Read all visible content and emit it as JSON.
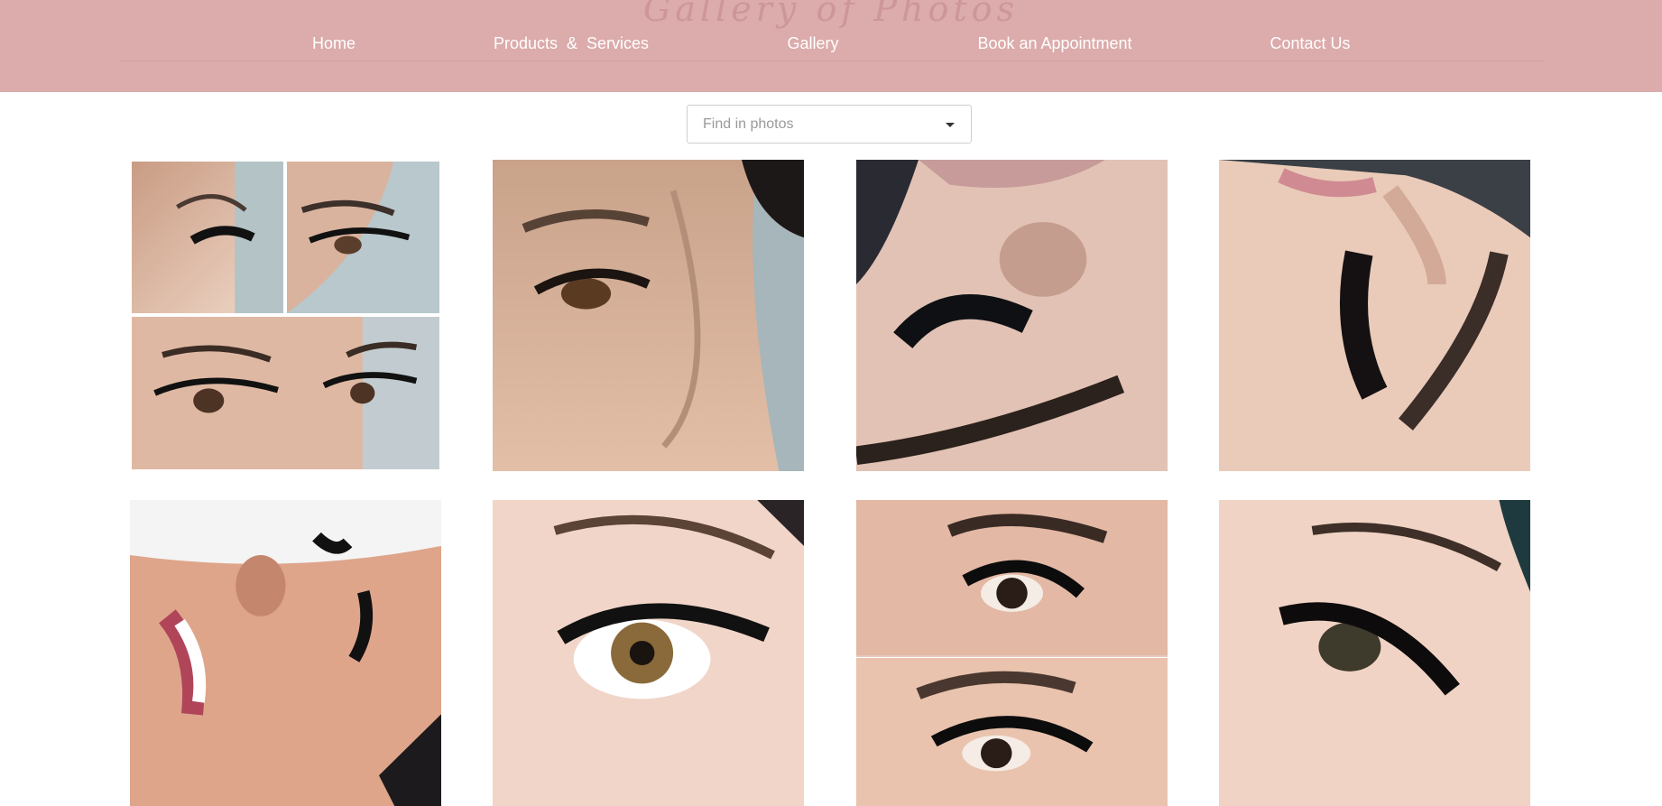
{
  "header": {
    "title": "Gallery of Photos",
    "nav": [
      {
        "label": "Home"
      },
      {
        "label": "Products  &  Services"
      },
      {
        "label": "Gallery"
      },
      {
        "label": "Book an Appointment"
      },
      {
        "label": "Contact Us"
      }
    ]
  },
  "search": {
    "placeholder": "Find in photos"
  },
  "colors": {
    "header_bg": "#dcabab",
    "nav_text": "#ffffff",
    "page_bg": "#ffffff"
  },
  "icons": {
    "dropdown": "caret-down-icon"
  }
}
